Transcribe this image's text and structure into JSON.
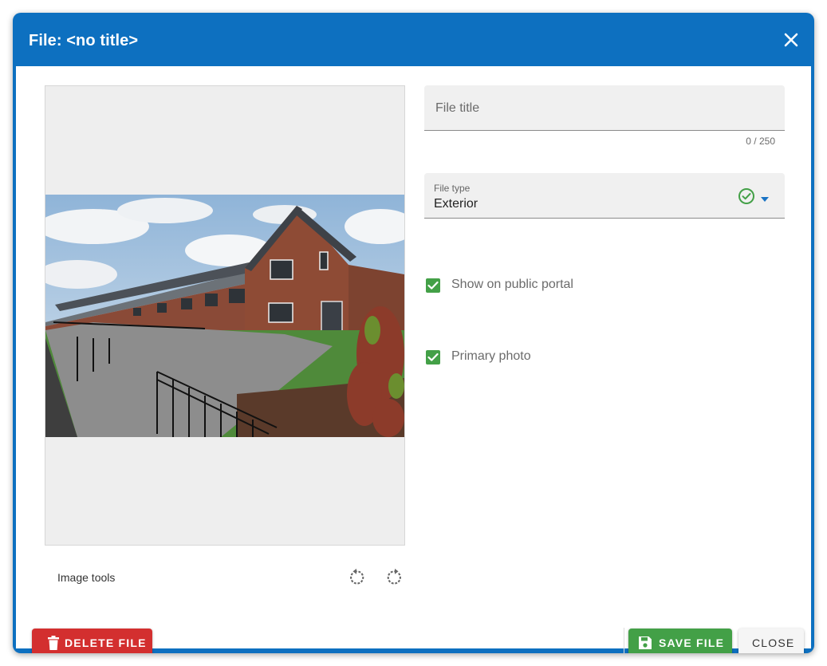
{
  "dialog": {
    "title": "File: <no title>"
  },
  "image": {
    "alt": "Terraced brick houses with a paved path and black railings",
    "tools_label": "Image tools"
  },
  "form": {
    "title_placeholder": "File title",
    "title_value": "",
    "counter": "0 / 250",
    "file_type_label": "File type",
    "file_type_value": "Exterior",
    "show_public_label": "Show on public portal",
    "show_public_checked": true,
    "primary_photo_label": "Primary photo",
    "primary_photo_checked": true
  },
  "footer": {
    "delete_label": "DELETE FILE",
    "save_label": "SAVE FILE",
    "close_label": "CLOSE"
  },
  "colors": {
    "header": "#0d70c0",
    "delete": "#d32f2f",
    "save": "#43a047",
    "checkbox": "#43a047"
  },
  "icons": {
    "close": "close-icon",
    "rotate_left": "rotate-left-icon",
    "rotate_right": "rotate-right-icon",
    "valid": "check-circle-icon",
    "dropdown": "triangle-down-icon",
    "delete": "trash-icon",
    "save": "floppy-disk-icon",
    "checkbox": "checkmark-icon"
  }
}
